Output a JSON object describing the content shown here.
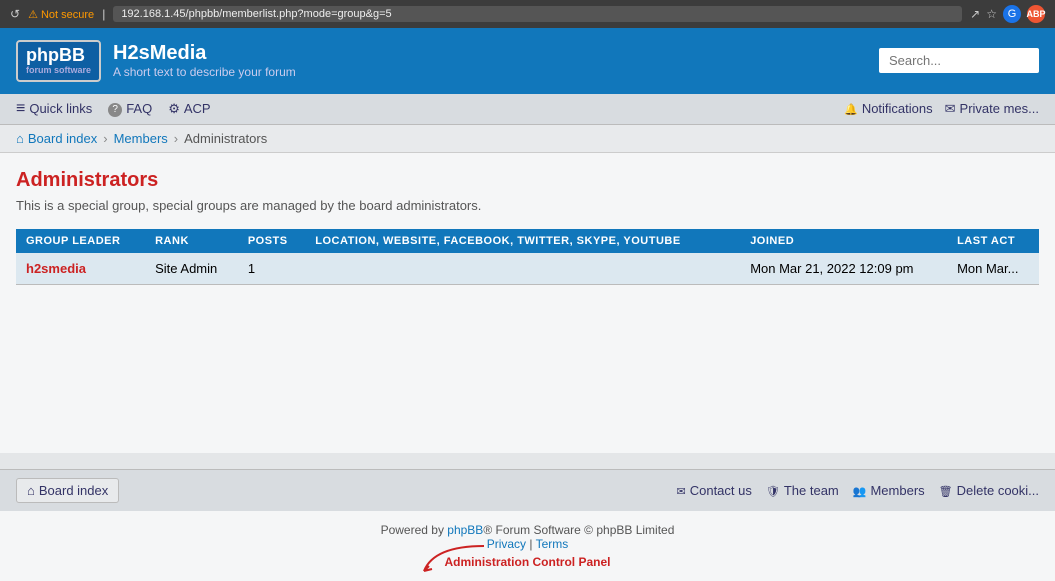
{
  "browser": {
    "security_warning": "Not secure",
    "url": "192.168.1.45/phpbb/memberlist.php?mode=group&g=5"
  },
  "header": {
    "logo_line1": "phpBB",
    "logo_line2": "forum software",
    "site_name": "H2sMedia",
    "site_desc": "A short text to describe your forum",
    "search_placeholder": "Search..."
  },
  "nav": {
    "quick_links": "Quick links",
    "faq": "FAQ",
    "acp": "ACP",
    "notifications": "Notifications",
    "private_messages": "Private mes..."
  },
  "breadcrumb": {
    "board_index": "Board index",
    "members": "Members",
    "current": "Administrators"
  },
  "page": {
    "title": "Administrators",
    "description": "This is a special group, special groups are managed by the board administrators."
  },
  "table": {
    "columns": [
      "GROUP LEADER",
      "RANK",
      "POSTS",
      "LOCATION, WEBSITE, FACEBOOK, TWITTER, SKYPE, YOUTUBE",
      "JOINED",
      "LAST ACT"
    ],
    "rows": [
      {
        "username": "h2smedia",
        "rank": "Site Admin",
        "posts": "1",
        "location": "",
        "joined": "Mon Mar 21, 2022 12:09 pm",
        "last_active": "Mon Mar..."
      }
    ]
  },
  "footer_nav": {
    "board_index": "Board index",
    "contact_us": "Contact us",
    "the_team": "The team",
    "members": "Members",
    "delete_cookies": "Delete cooki..."
  },
  "footer": {
    "powered_by": "Powered by ",
    "phpbb_link": "phpBB",
    "copyright": "® Forum Software © phpBB Limited",
    "privacy": "Privacy",
    "terms": "Terms",
    "admin_panel": "Administration Control Panel"
  }
}
